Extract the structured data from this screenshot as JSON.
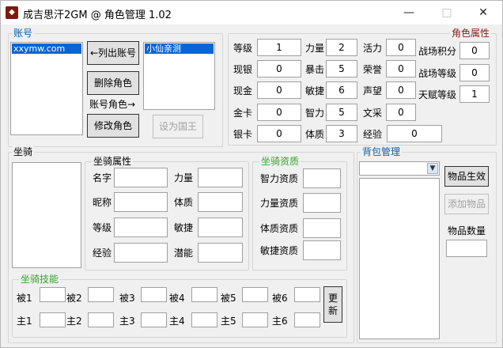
{
  "window": {
    "title": "成吉思汗2GM @ 角色管理 1.02",
    "minimize": "—",
    "maximize": "□",
    "close": "✕"
  },
  "account": {
    "label": "账号",
    "accounts": [
      "xxymw.com"
    ],
    "list_account_button": "←列出账号",
    "delete_role_button": "删除角色",
    "account_role_label": "账号角色→",
    "modify_role_button": "修改角色",
    "roles": [
      "小仙亲测"
    ],
    "set_king_button": "设为国王"
  },
  "attributes": {
    "label": "角色属性",
    "col1": [
      {
        "label": "等级",
        "value": "1"
      },
      {
        "label": "现银",
        "value": "0"
      },
      {
        "label": "现金",
        "value": "0"
      },
      {
        "label": "金卡",
        "value": "0"
      },
      {
        "label": "银卡",
        "value": "0"
      }
    ],
    "col2": [
      {
        "label": "力量",
        "value": "2"
      },
      {
        "label": "暴击",
        "value": "5"
      },
      {
        "label": "敏捷",
        "value": "6"
      },
      {
        "label": "智力",
        "value": "5"
      },
      {
        "label": "体质",
        "value": "3"
      }
    ],
    "col3": [
      {
        "label": "活力",
        "value": "0"
      },
      {
        "label": "荣誉",
        "value": "0"
      },
      {
        "label": "声望",
        "value": "0"
      },
      {
        "label": "文采",
        "value": "0"
      },
      {
        "label": "经验",
        "value": "0"
      }
    ],
    "col4": [
      {
        "label": "战场积分",
        "value": "0"
      },
      {
        "label": "战场等级",
        "value": "0"
      },
      {
        "label": "天赋等级",
        "value": "1"
      }
    ]
  },
  "mount": {
    "label": "坐骑",
    "attr_label": "坐骑属性",
    "attr_left": [
      {
        "label": "名字",
        "value": ""
      },
      {
        "label": "昵称",
        "value": ""
      },
      {
        "label": "等级",
        "value": ""
      },
      {
        "label": "经验",
        "value": ""
      }
    ],
    "attr_right": [
      {
        "label": "力量",
        "value": ""
      },
      {
        "label": "体质",
        "value": ""
      },
      {
        "label": "敏捷",
        "value": ""
      },
      {
        "label": "潜能",
        "value": ""
      }
    ],
    "aptitude_label": "坐骑资质",
    "aptitudes": [
      {
        "label": "智力资质",
        "value": ""
      },
      {
        "label": "力量资质",
        "value": ""
      },
      {
        "label": "体质资质",
        "value": ""
      },
      {
        "label": "敏捷资质",
        "value": ""
      }
    ],
    "skills_label": "坐骑技能",
    "passive": [
      {
        "label": "被1",
        "value": ""
      },
      {
        "label": "被2",
        "value": ""
      },
      {
        "label": "被3",
        "value": ""
      },
      {
        "label": "被4",
        "value": ""
      },
      {
        "label": "被5",
        "value": ""
      },
      {
        "label": "被6",
        "value": ""
      }
    ],
    "active": [
      {
        "label": "主1",
        "value": ""
      },
      {
        "label": "主2",
        "value": ""
      },
      {
        "label": "主3",
        "value": ""
      },
      {
        "label": "主4",
        "value": ""
      },
      {
        "label": "主5",
        "value": ""
      },
      {
        "label": "主6",
        "value": ""
      }
    ],
    "refresh_button": "更新"
  },
  "bag": {
    "label": "背包管理",
    "dropdown_value": "",
    "apply_button": "物品生效",
    "add_button": "添加物品",
    "quantity_label": "物品数量",
    "quantity_value": ""
  },
  "colors": {
    "blue_label": "#0e5da8",
    "green_label": "#33a52b",
    "selection": "#0a64d6"
  }
}
